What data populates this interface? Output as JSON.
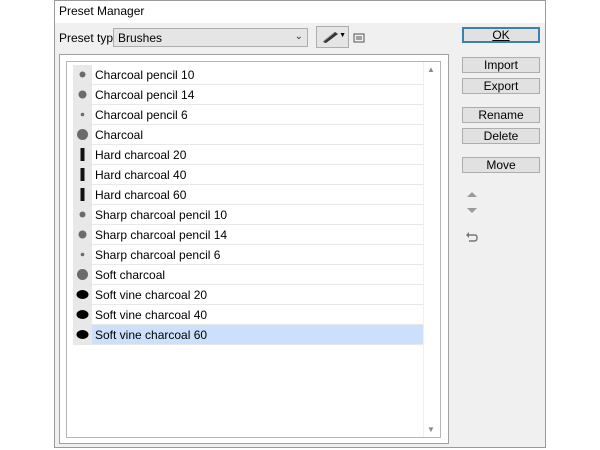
{
  "window": {
    "title": "Preset Manager"
  },
  "preset_type": {
    "label": "Preset type:",
    "value": "Brushes"
  },
  "buttons": {
    "ok": "OK",
    "import": "Import",
    "export": "Export",
    "rename": "Rename",
    "delete": "Delete",
    "move": "Move"
  },
  "icons": {
    "brush_preview": "brush-stroke-icon",
    "dropdown": "chevron-down-icon",
    "options": "panel-options-icon",
    "move_up": "triangle-up-icon",
    "move_down": "triangle-down-icon",
    "reset": "undo-icon"
  },
  "colors": {
    "selection": "#cce0fc",
    "default_button_border": "#3c7fb1"
  },
  "presets": [
    {
      "name": "Charcoal pencil 10",
      "thumb": "soft-dot-small"
    },
    {
      "name": "Charcoal pencil 14",
      "thumb": "soft-dot-medium"
    },
    {
      "name": "Charcoal pencil 6",
      "thumb": "soft-dot-tiny"
    },
    {
      "name": "Charcoal",
      "thumb": "soft-dot-large"
    },
    {
      "name": "Hard charcoal 20",
      "thumb": "vertical-bar"
    },
    {
      "name": "Hard charcoal 40",
      "thumb": "vertical-bar"
    },
    {
      "name": "Hard charcoal 60",
      "thumb": "vertical-bar"
    },
    {
      "name": "Sharp charcoal pencil 10",
      "thumb": "soft-dot-small"
    },
    {
      "name": "Sharp charcoal pencil 14",
      "thumb": "soft-dot-medium"
    },
    {
      "name": "Sharp charcoal pencil 6",
      "thumb": "soft-dot-tiny"
    },
    {
      "name": "Soft charcoal",
      "thumb": "soft-dot-large"
    },
    {
      "name": "Soft vine charcoal 20",
      "thumb": "blob"
    },
    {
      "name": "Soft vine charcoal 40",
      "thumb": "blob"
    },
    {
      "name": "Soft vine charcoal 60",
      "thumb": "blob",
      "selected": true
    }
  ]
}
